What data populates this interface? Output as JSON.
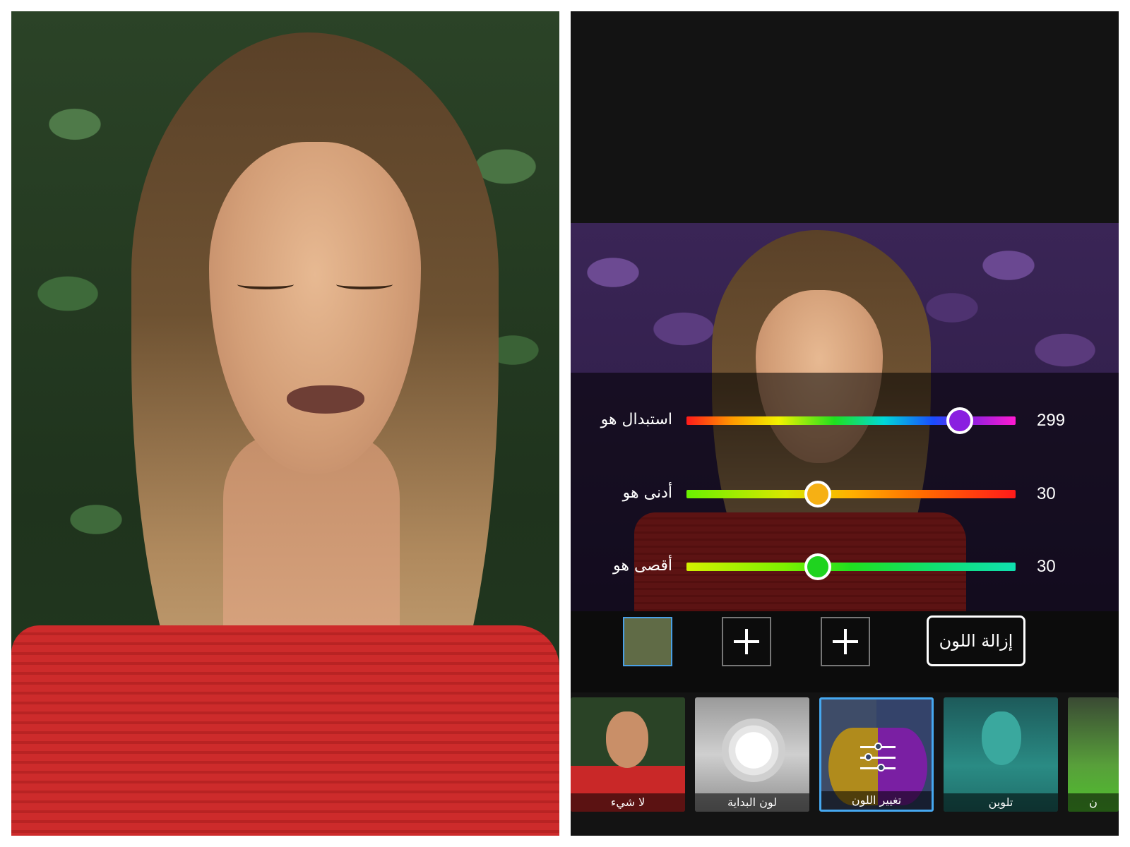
{
  "sliders": [
    {
      "label": "استبدال هو",
      "value": "299",
      "level": 0.83,
      "knob_color": "#8a1fe0",
      "track": "rainbow"
    },
    {
      "label": "أدنى هو",
      "value": "30",
      "level": 0.4,
      "knob_color": "#f6b014",
      "track": "green-to-red"
    },
    {
      "label": "أقصى هو",
      "value": "30",
      "level": 0.4,
      "knob_color": "#1fd31f",
      "track": "yellow-to-cyan"
    }
  ],
  "toolbar": {
    "selected_swatch_color": "#606b46",
    "add_color_1": "add-color",
    "add_color_2": "add-color",
    "remove_color_label": "إزالة اللون"
  },
  "filters": [
    {
      "label": "لا شيء"
    },
    {
      "label": "لون البداية"
    },
    {
      "label": "تغيير اللون",
      "selected": true
    },
    {
      "label": "تلوين"
    },
    {
      "label": "ن"
    }
  ],
  "colors": {
    "accent": "#46a8f0",
    "app_background": "#131313"
  }
}
